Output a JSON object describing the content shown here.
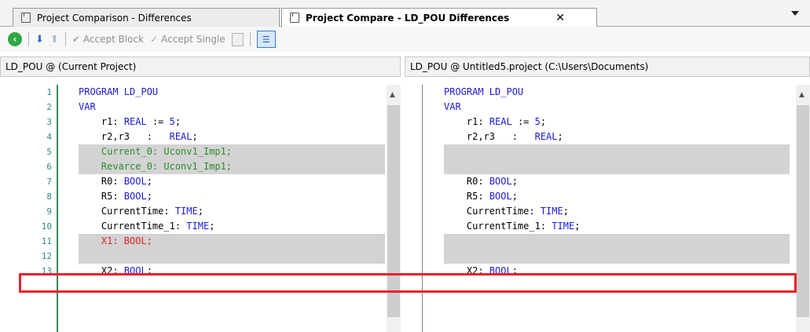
{
  "tabs": [
    {
      "label": "Project Comparison - Differences",
      "active": false
    },
    {
      "label": "Project Compare - LD_POU Differences",
      "active": true
    }
  ],
  "toolbar": {
    "accept_block": "Accept Block",
    "accept_single": "Accept Single"
  },
  "left_pane": {
    "header": "LD_POU @ (Current Project)",
    "line_numbers": [
      "1",
      "2",
      "3",
      "4",
      "5",
      "6",
      "7",
      "8",
      "9",
      "10",
      "11",
      "12",
      "13"
    ]
  },
  "right_pane": {
    "header": "LD_POU @ Untitled5.project (C:\\Users\\Documents)"
  },
  "code": {
    "l1_a": "PROGRAM LD_POU",
    "l2_a": "VAR",
    "l3_a": "r1: ",
    "l3_b": "REAL",
    "l3_c": " := ",
    "l3_d": "5",
    "l3_e": ";",
    "l4_a": "r2,r3   :   ",
    "l4_b": "REAL",
    "l4_c": ";",
    "l5_a": "Current_0: Uconv1_Imp1;",
    "l6_a": "Revarce_0: Uconv1_Imp1;",
    "l7_a": "R0: ",
    "l7_b": "BOOL",
    "l7_c": ";",
    "l8_a": "R5: ",
    "l8_b": "BOOL",
    "l8_c": ";",
    "l9_a": "CurrentTime: ",
    "l9_b": "TIME",
    "l9_c": ";",
    "l10_a": "CurrentTime_1: ",
    "l10_b": "TIME",
    "l10_c": ";",
    "l11_a": "X1: BOOL;",
    "l13_a": "X2: ",
    "l13_b": "BOOL",
    "l13_c": ";"
  },
  "colors": {
    "added": "#2e8b2e",
    "removed": "#e02020",
    "keyword": "#1a1adc",
    "diff_highlight": "#d3d3d3",
    "callout": "#e8212e"
  }
}
